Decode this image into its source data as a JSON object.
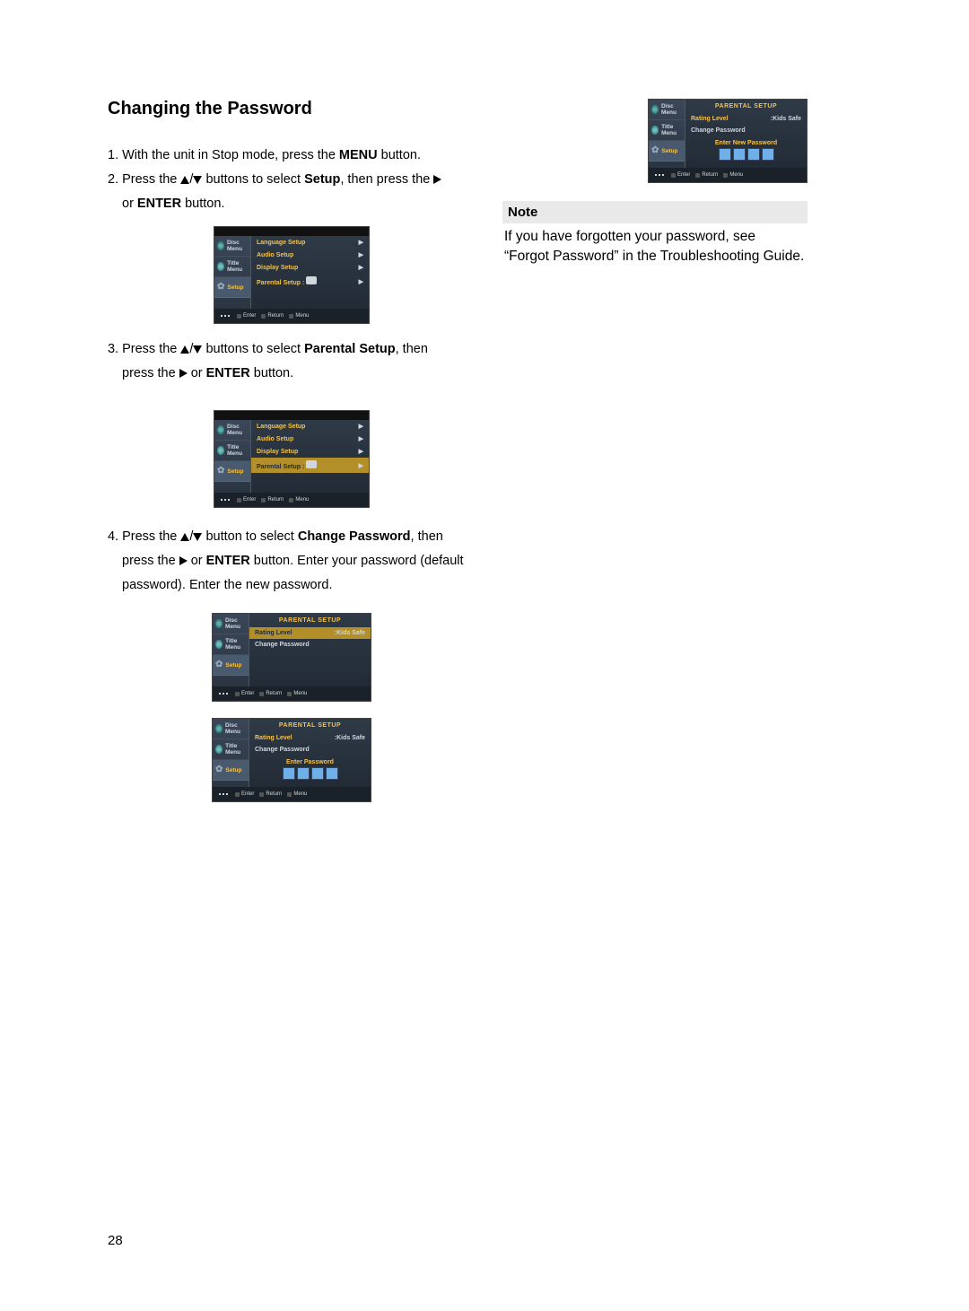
{
  "heading": "Changing the Password",
  "steps": {
    "s1a": "1. With the unit in Stop mode, press the ",
    "s1b": "MENU",
    "s1c": " button.",
    "s2a": "2. Press the ",
    "s2b": " buttons to select ",
    "s2c": "Setup",
    "s2d": ", then press the ",
    "s2e": "or ",
    "s2f": "ENTER",
    "s2g": " button.",
    "s3a": "3. Press the ",
    "s3b": " buttons to select ",
    "s3c": "Parental Setup",
    "s3d": ", then",
    "s3e": "press the ",
    "s3f": " or ",
    "s3g": "ENTER",
    "s3h": " button.",
    "s4a": "4. Press the ",
    "s4b": " button to select ",
    "s4c": "Change Password",
    "s4d": ", then",
    "s4e": "press the ",
    "s4f": " or ",
    "s4g": "ENTER",
    "s4h": " button. Enter your password (default",
    "s4i": "password). Enter the new password."
  },
  "osd": {
    "side": {
      "disc": "Disc Menu",
      "title": "Title Menu",
      "setup": "Setup"
    },
    "menu": {
      "lang": "Language Setup",
      "audio": "Audio Setup",
      "display": "Display Setup",
      "parental": "Parental Setup  :"
    },
    "parental_title": "PARENTAL  SETUP",
    "rating": "Rating Level",
    "rating_val": ":Kids Safe",
    "change": "Change Password",
    "enter_pw": "Enter Password",
    "enter_new": "Enter New Password",
    "foot": {
      "enter": "Enter",
      "return": "Return",
      "menu": "Menu"
    }
  },
  "note": {
    "title": "Note",
    "line1": "If you have forgotten your password, see",
    "line2": "“Forgot Password” in the Troubleshooting Guide."
  },
  "page_number": "28"
}
